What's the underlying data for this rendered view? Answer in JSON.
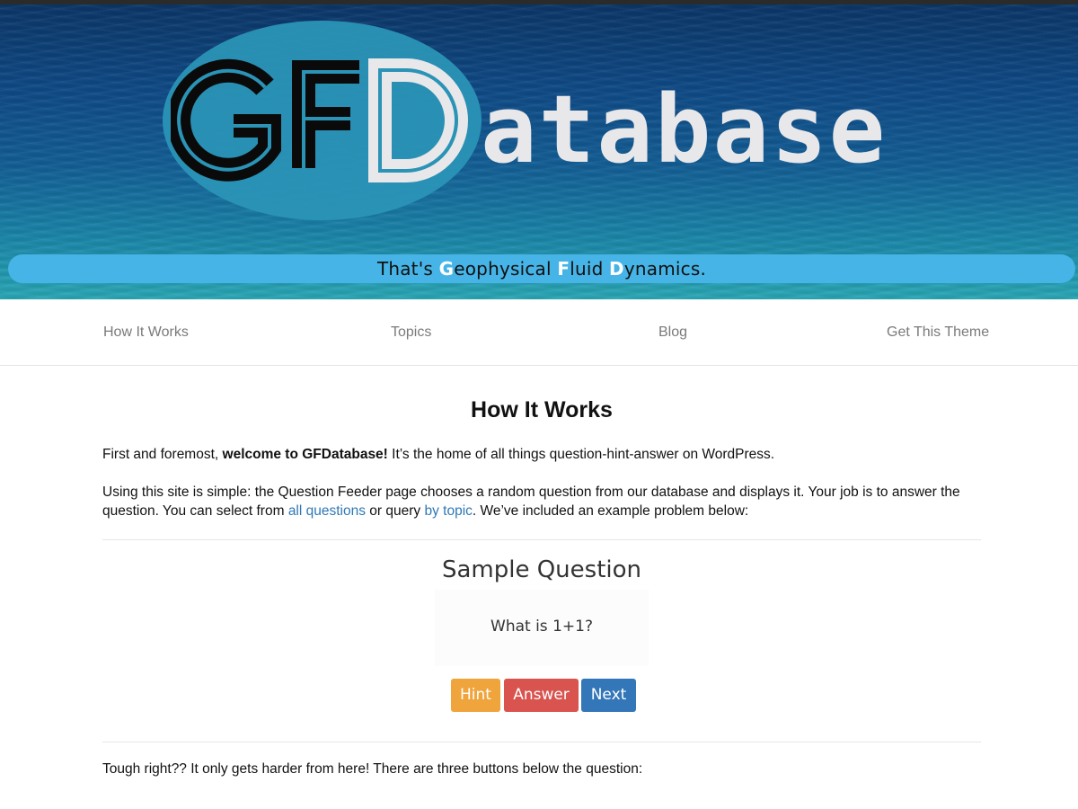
{
  "header": {
    "logo_text": "GFDatabase",
    "tagline": {
      "part1": "That's ",
      "g": "G",
      "part2": "eophysical ",
      "f": "F",
      "part3": "luid ",
      "d": "D",
      "part4": "ynamics."
    }
  },
  "nav": {
    "items": [
      {
        "label": "How It Works"
      },
      {
        "label": "Topics"
      },
      {
        "label": "Blog"
      },
      {
        "label": "Get This Theme"
      }
    ]
  },
  "main": {
    "title": "How It Works",
    "p1": {
      "pre": "First and foremost, ",
      "bold": "welcome to GFDatabase!",
      "post": " It’s the home of all things question-hint-answer on WordPress."
    },
    "p2": {
      "pre": "Using this site is simple: the Question Feeder page chooses a random question from our database and displays it. Your job is to answer the question. You can select from ",
      "link1": "all questions",
      "mid": " or query ",
      "link2": "by topic",
      "post": ". We’ve included an example problem below:"
    },
    "sample": {
      "title": "Sample Question",
      "question": "What is 1+1?",
      "buttons": {
        "hint": "Hint",
        "answer": "Answer",
        "next": "Next"
      }
    },
    "p3": "Tough right?? It only gets harder from here! There are three buttons below the question:"
  },
  "colors": {
    "tagline_bar": "#46b4e6",
    "link": "#2f78b7",
    "hint_button": "#efa43c",
    "answer_button": "#d9534f",
    "next_button": "#3477b9"
  }
}
